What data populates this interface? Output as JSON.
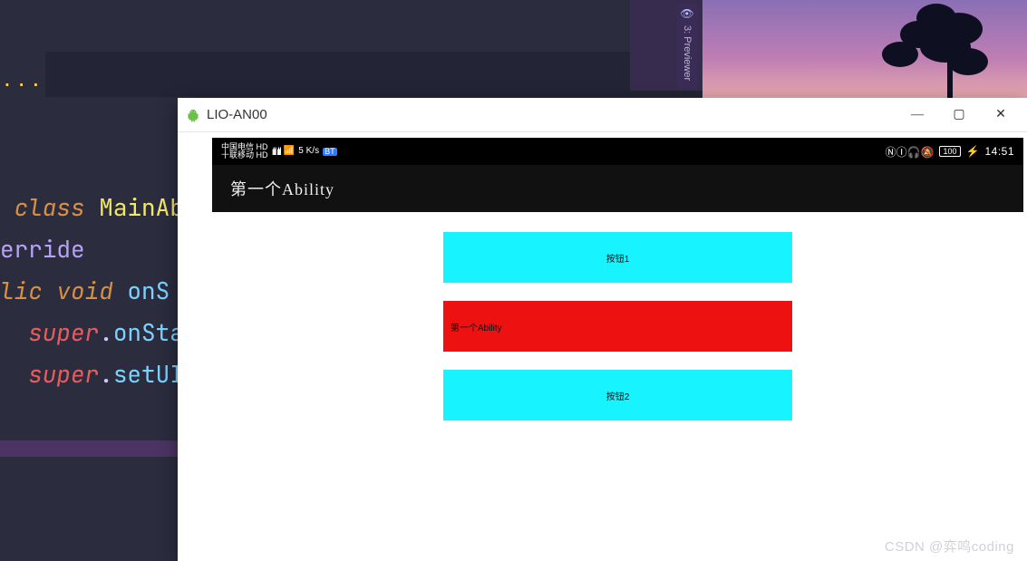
{
  "ide": {
    "ellipsis": "...",
    "code": {
      "l1_kw": "class ",
      "l1_cls": "MainAb",
      "l2": "erride",
      "l3_kw": "lic void ",
      "l3_m": "onS",
      "l4_super": "super",
      "l4_dot": ".",
      "l4_m": "onSta",
      "l5_super": "super",
      "l5_dot": ".",
      "l5_m": "setUI"
    },
    "previewer_label": "3: Previewer"
  },
  "emulator": {
    "window_title": "LIO-AN00",
    "controls": {
      "minimize": "—",
      "maximize": "▢",
      "close": "✕"
    },
    "status": {
      "carrier1": "中国电信 HD",
      "carrier2": "十联移动 HD",
      "signals": "ılıl ılıl",
      "wifi": "📶",
      "speed": "5 K/s",
      "bt": "BT",
      "right_icons": "ⓃⒾ🎧🔕",
      "battery": "100",
      "clock": "14:51"
    },
    "app_title": "第一个Ability",
    "buttons": {
      "b1": "按钮1",
      "b2": "第一个Ability",
      "b3": "按钮2"
    }
  },
  "watermark": "CSDN @弈鸣coding"
}
